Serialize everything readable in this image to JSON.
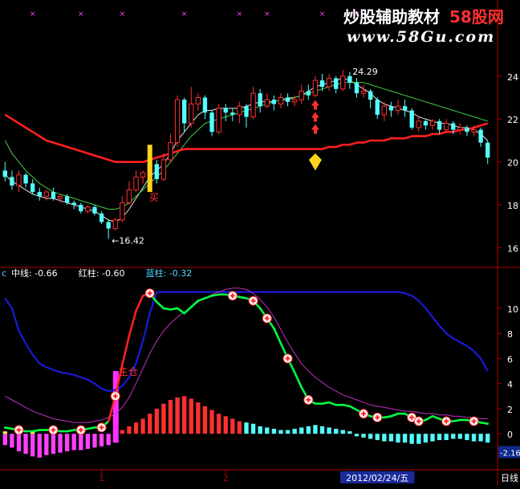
{
  "watermark": {
    "line1": "炒股辅助教材",
    "line1_suffix": "58股网",
    "line2": "www.58Gu.com"
  },
  "chart_data": [
    {
      "type": "candlestick",
      "panel": "price",
      "y_ticks": [
        16,
        18,
        20,
        22,
        24
      ],
      "ylim": [
        15.2,
        25.3
      ],
      "annotations": {
        "high": "24.29",
        "low": "16.42",
        "buy_mark": "买"
      },
      "candles": [
        [
          19.6,
          19.3,
          20.0,
          19.1
        ],
        [
          19.3,
          18.9,
          19.6,
          18.7
        ],
        [
          18.9,
          19.4,
          19.6,
          18.6
        ],
        [
          19.4,
          19.0,
          19.5,
          18.8
        ],
        [
          19.0,
          18.6,
          19.2,
          18.5
        ],
        [
          18.6,
          18.4,
          18.8,
          18.2
        ],
        [
          18.4,
          18.6,
          18.7,
          18.2
        ],
        [
          18.6,
          18.3,
          18.8,
          18.2
        ],
        [
          18.3,
          18.4,
          18.5,
          18.1
        ],
        [
          18.4,
          18.1,
          18.5,
          18.0
        ],
        [
          18.1,
          18.0,
          18.2,
          17.8
        ],
        [
          18.0,
          17.7,
          18.1,
          17.6
        ],
        [
          17.7,
          17.9,
          18.0,
          17.6
        ],
        [
          17.9,
          17.6,
          18.0,
          17.5
        ],
        [
          17.6,
          17.2,
          17.7,
          17.1
        ],
        [
          17.2,
          16.9,
          17.3,
          16.42
        ],
        [
          16.9,
          17.3,
          17.4,
          16.8
        ],
        [
          17.3,
          18.1,
          18.4,
          17.2
        ],
        [
          18.1,
          18.7,
          19.1,
          18.0
        ],
        [
          18.7,
          19.3,
          19.6,
          18.6
        ],
        [
          19.3,
          19.5,
          19.6,
          19.0
        ],
        [
          19.5,
          19.9,
          20.2,
          19.3
        ],
        [
          19.9,
          19.2,
          20.1,
          19.0
        ],
        [
          19.2,
          20.1,
          20.4,
          19.1
        ],
        [
          20.1,
          20.9,
          21.3,
          20.0
        ],
        [
          20.9,
          22.9,
          23.1,
          20.7
        ],
        [
          22.9,
          21.8,
          23.0,
          21.4
        ],
        [
          21.8,
          22.7,
          23.5,
          21.6
        ],
        [
          22.7,
          23.0,
          23.2,
          22.4
        ],
        [
          23.0,
          22.3,
          23.1,
          22.0
        ],
        [
          22.3,
          21.4,
          22.4,
          21.2
        ],
        [
          21.4,
          22.5,
          22.7,
          21.3
        ],
        [
          22.5,
          22.3,
          22.7,
          21.9
        ],
        [
          22.3,
          22.2,
          22.5,
          21.9
        ],
        [
          22.2,
          22.6,
          22.8,
          21.8
        ],
        [
          22.6,
          22.1,
          22.7,
          21.6
        ],
        [
          22.1,
          23.2,
          23.5,
          22.0
        ],
        [
          23.2,
          22.6,
          23.4,
          22.3
        ],
        [
          22.6,
          22.9,
          23.2,
          22.5
        ],
        [
          22.9,
          22.7,
          23.1,
          22.4
        ],
        [
          22.7,
          23.0,
          23.2,
          22.5
        ],
        [
          23.0,
          22.8,
          23.2,
          22.6
        ],
        [
          22.8,
          22.9,
          23.1,
          22.6
        ],
        [
          22.9,
          23.3,
          23.6,
          22.7
        ],
        [
          23.3,
          23.1,
          23.6,
          22.9
        ],
        [
          23.1,
          23.8,
          24.0,
          23.0
        ],
        [
          23.8,
          23.5,
          24.1,
          23.3
        ],
        [
          23.5,
          23.9,
          24.1,
          23.3
        ],
        [
          23.9,
          23.4,
          24.0,
          23.2
        ],
        [
          23.4,
          24.0,
          24.29,
          23.3
        ],
        [
          24.0,
          23.7,
          24.2,
          23.4
        ],
        [
          23.7,
          23.2,
          23.9,
          23.0
        ],
        [
          23.2,
          23.3,
          23.6,
          23.0
        ],
        [
          23.3,
          22.9,
          23.4,
          22.5
        ],
        [
          22.9,
          22.2,
          23.0,
          22.0
        ],
        [
          22.2,
          22.6,
          22.8,
          21.9
        ],
        [
          22.6,
          22.4,
          22.8,
          22.1
        ],
        [
          22.4,
          22.6,
          22.9,
          22.2
        ],
        [
          22.6,
          22.4,
          22.9,
          22.1
        ],
        [
          22.4,
          21.6,
          22.5,
          21.5
        ],
        [
          21.6,
          21.9,
          22.1,
          21.4
        ],
        [
          21.9,
          21.7,
          22.0,
          21.5
        ],
        [
          21.7,
          21.9,
          22.0,
          21.5
        ],
        [
          21.9,
          21.5,
          22.0,
          21.3
        ],
        [
          21.5,
          21.8,
          22.0,
          21.4
        ],
        [
          21.8,
          21.5,
          21.9,
          21.3
        ],
        [
          21.5,
          21.6,
          21.8,
          21.3
        ],
        [
          21.6,
          21.4,
          21.7,
          21.2
        ],
        [
          21.4,
          21.5,
          21.7,
          21.2
        ],
        [
          21.5,
          20.9,
          21.6,
          20.7
        ],
        [
          20.9,
          20.2,
          21.0,
          19.9
        ]
      ],
      "red_ma": [
        22.2,
        22.0,
        21.8,
        21.6,
        21.4,
        21.2,
        21.0,
        20.9,
        20.8,
        20.7,
        20.6,
        20.5,
        20.4,
        20.3,
        20.2,
        20.1,
        20.0,
        20.0,
        20.0,
        20.0,
        20.0,
        20.1,
        20.2,
        20.3,
        20.4,
        20.5,
        20.6,
        20.6,
        20.6,
        20.6,
        20.6,
        20.6,
        20.6,
        20.6,
        20.6,
        20.6,
        20.6,
        20.6,
        20.6,
        20.6,
        20.6,
        20.6,
        20.6,
        20.6,
        20.6,
        20.6,
        20.6,
        20.7,
        20.7,
        20.8,
        20.8,
        20.9,
        20.9,
        21.0,
        21.0,
        21.0,
        21.1,
        21.1,
        21.1,
        21.2,
        21.2,
        21.2,
        21.3,
        21.3,
        21.4,
        21.4,
        21.5,
        21.5,
        21.6,
        21.7,
        21.8
      ],
      "green_ma": [
        21.0,
        20.4,
        20.0,
        19.6,
        19.3,
        19.0,
        18.8,
        18.6,
        18.5,
        18.4,
        18.3,
        18.2,
        18.1,
        18.0,
        17.9,
        17.8,
        17.8,
        17.9,
        18.1,
        18.4,
        18.7,
        19.0,
        19.3,
        19.6,
        20.0,
        20.4,
        20.8,
        21.2,
        21.5,
        21.8,
        21.9,
        22.0,
        22.1,
        22.2,
        22.3,
        22.4,
        22.5,
        22.6,
        22.7,
        22.8,
        22.9,
        23.0,
        23.0,
        23.1,
        23.2,
        23.3,
        23.4,
        23.5,
        23.6,
        23.7,
        23.7,
        23.7,
        23.7,
        23.6,
        23.5,
        23.4,
        23.3,
        23.2,
        23.1,
        23.0,
        22.9,
        22.8,
        22.7,
        22.6,
        22.5,
        22.4,
        22.3,
        22.2,
        22.1,
        22.0,
        21.9
      ],
      "yellow_ma": [
        19.4,
        19.1,
        18.9,
        18.7,
        18.5,
        18.4,
        18.3,
        18.3,
        18.2,
        18.1,
        18.0,
        17.9,
        17.8,
        17.7,
        17.5,
        17.3,
        17.2,
        17.4,
        17.8,
        18.3,
        18.8,
        19.3,
        19.6,
        19.9,
        20.4,
        21.0,
        21.4,
        21.8,
        22.2,
        22.4,
        22.4,
        22.5,
        22.5,
        22.5,
        22.5,
        22.6,
        22.7,
        22.8,
        22.8,
        22.8,
        22.9,
        22.9,
        23.0,
        23.1,
        23.3,
        23.5,
        23.6,
        23.7,
        23.8,
        23.9,
        23.8,
        23.6,
        23.4,
        23.2,
        22.9,
        22.7,
        22.6,
        22.5,
        22.4,
        22.3,
        22.1,
        22.0,
        21.9,
        21.8,
        21.8,
        21.7,
        21.6,
        21.6,
        21.5,
        21.3,
        21.0
      ]
    },
    {
      "type": "indicator",
      "panel": "indicator",
      "legend": [
        {
          "label": "中线: -0.66",
          "color": "#ffffff"
        },
        {
          "label": "红柱: -0.60",
          "color": "#ffffff"
        },
        {
          "label": "蓝柱: -0.32",
          "color": "#4fd6ff"
        }
      ],
      "y_ticks": [
        0,
        2,
        4,
        6,
        8,
        10
      ],
      "ylim": [
        -2.8,
        12.3
      ],
      "current_value": "-2.16",
      "x_ticks": [
        {
          "label": "1",
          "index": 14
        },
        {
          "label": "2",
          "index": 32
        },
        {
          "label": "2012/02/24/五",
          "index": 54,
          "highlight": true
        }
      ],
      "period_label": "日线",
      "signal_text": "主仓",
      "hist_bars": [
        -0.9,
        -1.1,
        -1.4,
        -1.6,
        -1.8,
        -1.9,
        -1.7,
        -1.6,
        -1.5,
        -1.4,
        -1.3,
        -1.3,
        -1.2,
        -1.1,
        -1.0,
        -0.9,
        -0.7,
        0.3,
        0.6,
        0.9,
        1.2,
        1.6,
        2.0,
        2.4,
        2.7,
        2.9,
        3.0,
        2.8,
        2.5,
        2.2,
        1.9,
        1.6,
        1.4,
        1.2,
        1.0,
        0.9,
        0.8,
        0.6,
        0.5,
        0.4,
        0.3,
        0.3,
        0.4,
        0.5,
        0.6,
        0.7,
        0.6,
        0.5,
        0.4,
        0.3,
        0.2,
        -0.2,
        -0.3,
        -0.4,
        -0.5,
        -0.6,
        -0.6,
        -0.7,
        -0.7,
        -0.8,
        -0.8,
        -0.7,
        -0.6,
        -0.5,
        -0.5,
        -0.4,
        -0.4,
        -0.5,
        -0.6,
        -0.6,
        -0.7
      ],
      "bright_line": [
        0.5,
        0.4,
        0.3,
        0.2,
        0.2,
        0.3,
        0.3,
        0.3,
        0.2,
        0.2,
        0.3,
        0.3,
        0.4,
        0.5,
        0.5,
        1.0,
        3.0,
        5.5,
        7.8,
        9.8,
        11.0,
        11.2,
        10.5,
        10.0,
        9.9,
        10.0,
        9.6,
        10.1,
        10.6,
        10.8,
        11.0,
        11.1,
        11.1,
        11.0,
        10.9,
        10.8,
        10.6,
        10.0,
        9.2,
        8.4,
        7.2,
        6.0,
        4.9,
        3.7,
        2.7,
        2.4,
        2.4,
        2.5,
        2.3,
        2.3,
        2.2,
        1.9,
        1.6,
        1.4,
        1.3,
        1.3,
        1.4,
        1.6,
        1.6,
        1.3,
        1.0,
        1.1,
        1.4,
        1.2,
        1.0,
        1.0,
        1.1,
        1.1,
        1.0,
        0.9,
        0.8
      ],
      "magenta_line": [
        3.0,
        2.7,
        2.4,
        2.1,
        1.8,
        1.6,
        1.4,
        1.2,
        1.1,
        1.0,
        0.9,
        0.9,
        0.9,
        1.0,
        1.1,
        1.3,
        1.6,
        2.1,
        2.9,
        4.0,
        5.2,
        6.4,
        7.4,
        8.2,
        8.8,
        9.3,
        9.7,
        10.1,
        10.5,
        10.8,
        11.1,
        11.3,
        11.5,
        11.6,
        11.6,
        11.5,
        11.2,
        10.7,
        10.1,
        9.3,
        8.3,
        7.3,
        6.4,
        5.6,
        5.0,
        4.5,
        4.1,
        3.7,
        3.4,
        3.1,
        2.9,
        2.7,
        2.5,
        2.3,
        2.2,
        2.1,
        2.0,
        1.9,
        1.8,
        1.8,
        1.7,
        1.6,
        1.6,
        1.5,
        1.5,
        1.4,
        1.4,
        1.3,
        1.3,
        1.2,
        1.2
      ],
      "blue_line": [
        10.8,
        10.0,
        8.2,
        7.2,
        6.3,
        5.6,
        5.3,
        5.1,
        4.9,
        4.8,
        4.7,
        4.5,
        4.3,
        4.0,
        3.6,
        3.4,
        3.5,
        3.8,
        4.5,
        5.6,
        7.4,
        9.6,
        11.3,
        11.3,
        11.3,
        11.3,
        11.3,
        11.3,
        11.3,
        11.3,
        11.3,
        11.3,
        11.3,
        11.3,
        11.3,
        11.3,
        11.3,
        11.3,
        11.3,
        11.3,
        11.3,
        11.3,
        11.3,
        11.3,
        11.3,
        11.3,
        11.3,
        11.3,
        11.3,
        11.3,
        11.3,
        11.3,
        11.3,
        11.3,
        11.3,
        11.3,
        11.3,
        11.3,
        11.2,
        11.0,
        10.6,
        10.0,
        9.3,
        8.6,
        8.0,
        7.6,
        7.3,
        7.0,
        6.6,
        6.0,
        5.0
      ],
      "markers": [
        2,
        7,
        11,
        14,
        16,
        21,
        33,
        36,
        38,
        41,
        44,
        52,
        54,
        59,
        60,
        64,
        68
      ],
      "colors": {
        "up": "#ff3030",
        "down": "#54ffff",
        "red_ma": "#ff2020",
        "green_ma": "#40d040",
        "yellow_ma": "#e0e0e0",
        "blue": "#1a1ad8",
        "magenta": "#c030c0",
        "bright": "#00ff40",
        "axis": "#b00000"
      }
    }
  ]
}
